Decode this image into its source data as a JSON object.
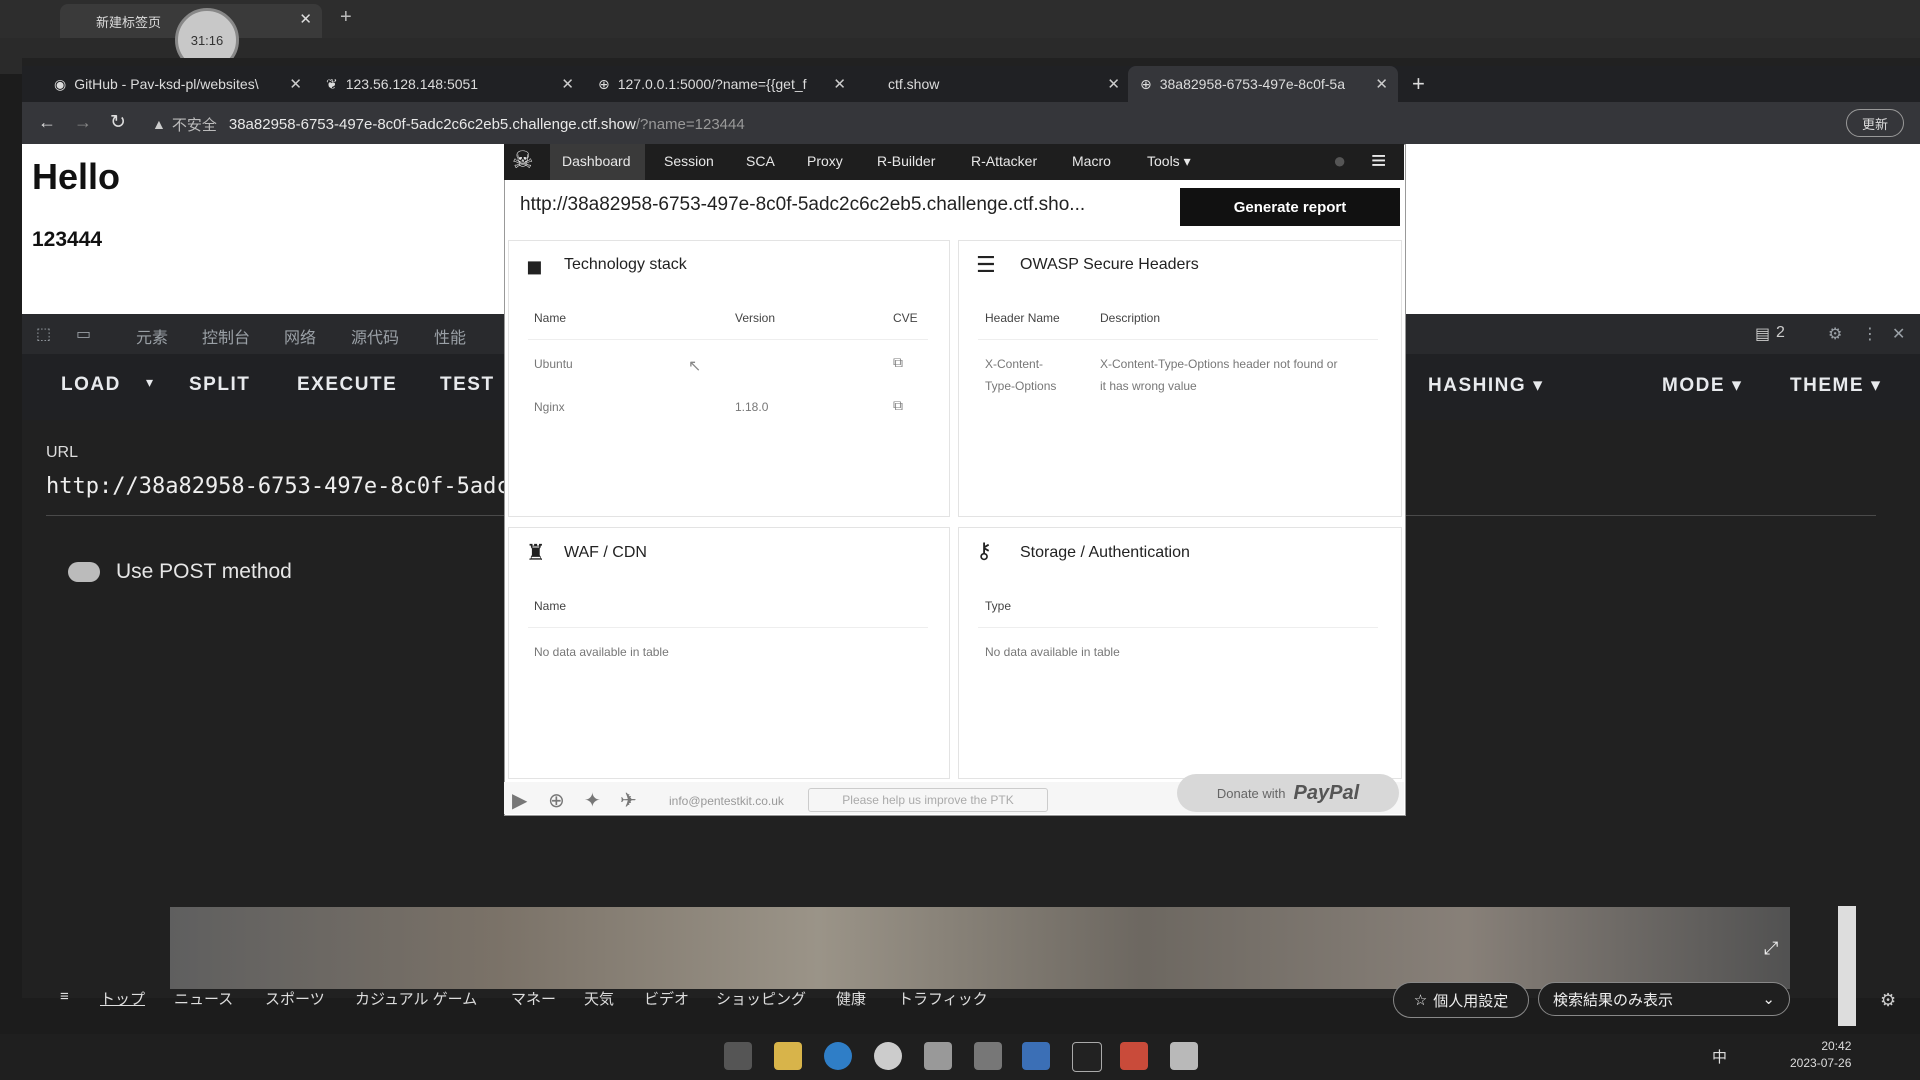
{
  "outer": {
    "tab_title": "新建标签页",
    "timer": "31:16"
  },
  "tabs": [
    {
      "label": "GitHub - Pav-ksd-pl/websites\\"
    },
    {
      "label": "123.56.128.148:5051"
    },
    {
      "label": "127.0.0.1:5000/?name={{get_f"
    },
    {
      "label": "ctf.show"
    },
    {
      "label": "38a82958-6753-497e-8c0f-5a"
    }
  ],
  "address": {
    "insecure": "不安全",
    "domain": "38a82958-6753-497e-8c0f-5adc2c6c2eb5.challenge.ctf.show",
    "path": "/?name=123444",
    "update": "更新"
  },
  "page": {
    "heading": "Hello",
    "value": "123444"
  },
  "devtools": {
    "tabs": [
      "元素",
      "控制台",
      "网络",
      "源代码",
      "性能"
    ],
    "issues": "2"
  },
  "hackbar": {
    "load": "LOAD",
    "split": "SPLIT",
    "execute": "EXECUTE",
    "test": "TEST",
    "hashing": "HASHING",
    "mode": "MODE",
    "theme": "THEME",
    "url_label": "URL",
    "url_value": "http://38a82958-6753-497e-8c0f-5adc2c6c2eb5.challenge.ctf.show/?name=123444",
    "post_label": "Use POST method"
  },
  "ptk": {
    "nav": [
      "Dashboard",
      "Session",
      "SCA",
      "Proxy",
      "R-Builder",
      "R-Attacker",
      "Macro",
      "Tools"
    ],
    "url": "http://38a82958-6753-497e-8c0f-5adc2c6c2eb5.challenge.ctf.sho...",
    "generate": "Generate report",
    "tech": {
      "title": "Technology stack",
      "cols": [
        "Name",
        "Version",
        "CVE"
      ],
      "rows": [
        {
          "name": "Ubuntu",
          "version": ""
        },
        {
          "name": "Nginx",
          "version": "1.18.0"
        }
      ]
    },
    "owasp": {
      "title": "OWASP Secure Headers",
      "cols": [
        "Header Name",
        "Description"
      ],
      "row": {
        "name_1": "X-Content-",
        "name_2": "Type-Options",
        "desc_1": "X-Content-Type-Options header not found or",
        "desc_2": "it has wrong value"
      }
    },
    "waf": {
      "title": "WAF / CDN",
      "col": "Name",
      "empty": "No data available in table"
    },
    "storage": {
      "title": "Storage / Authentication",
      "col": "Type",
      "empty": "No data available in table"
    },
    "footer": {
      "email": "info@pentestkit.co.uk",
      "feedback": "Please help us improve the PTK",
      "donate": "Donate with",
      "paypal": "PayPal"
    }
  },
  "news": {
    "items": [
      "トップ",
      "ニュース",
      "スポーツ",
      "カジュアル ゲーム",
      "マネー",
      "天気",
      "ビデオ",
      "ショッピング",
      "健康",
      "トラフィック"
    ],
    "personal": "個人用設定",
    "search_mode": "検索結果のみ表示"
  },
  "clock": {
    "time": "20:42",
    "date": "2023-07-26"
  },
  "tray": {
    "ime": "中"
  }
}
